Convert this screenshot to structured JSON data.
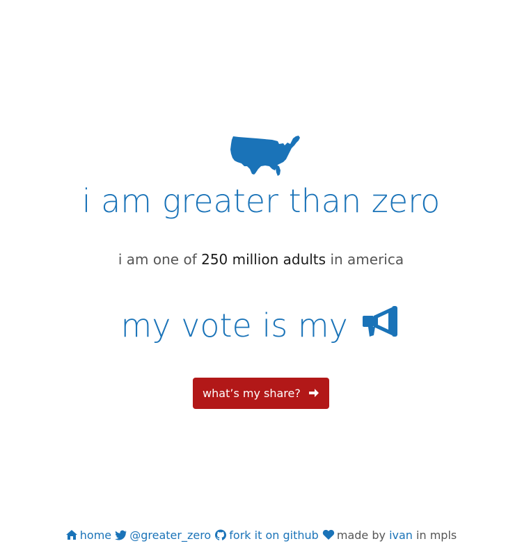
{
  "hero": {
    "icon": "usa-map-icon",
    "headline": "i am greater than zero",
    "subline": {
      "prefix": "i am one of",
      "emphasis": "250 million adults",
      "suffix": "in america"
    },
    "vote_line": {
      "text": "my vote is my",
      "icon": "megaphone-icon"
    },
    "share_button": {
      "label": "what’s my share?",
      "icon": "arrow-right-icon"
    }
  },
  "footer": {
    "home_label": "home",
    "twitter_label": "@greater_zero",
    "github_label": "fork it on github",
    "made_by_prefix": "made by",
    "author_label": "ivan",
    "location_suffix": "in mpls"
  },
  "colors": {
    "primary_blue": "#1a73b8",
    "button_red": "#b21818",
    "body_text": "#555555",
    "emphasis_text": "#1a1a1a",
    "background": "#ffffff"
  }
}
